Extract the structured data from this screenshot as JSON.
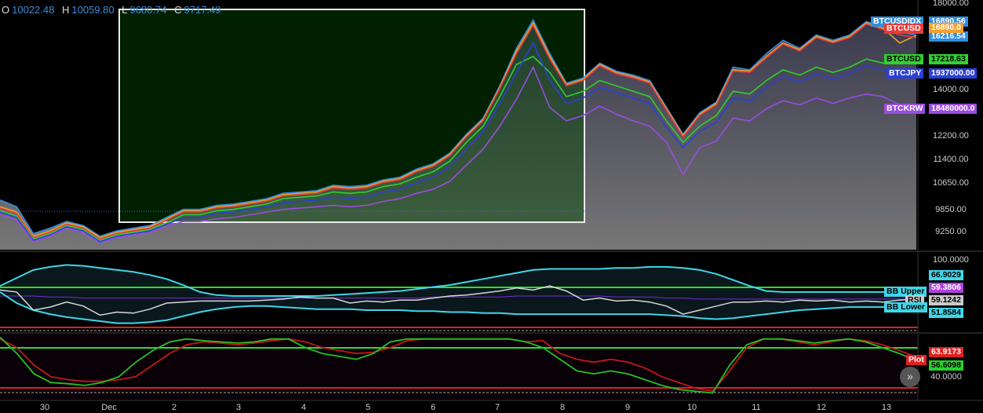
{
  "ohlc": {
    "o_label": "O",
    "o": "10022.48",
    "h_label": "H",
    "h": "10059.80",
    "l_label": "L",
    "l": "9680.74",
    "c_label": "C",
    "c": "9717.49"
  },
  "colors": {
    "BTCUSDIDX": "#2f8ee0",
    "BTCUSD_orange": "#f0a030",
    "BTCUSD_red": "#e83a3a",
    "BTCUSD_green": "#30d030",
    "BTCJPY": "#2b3fd8",
    "BTCKRW": "#9a4ce0",
    "rsi": "#d8d8d8",
    "bb": "#3fd6e8",
    "stoch_k": "#26c026",
    "stoch_d": "#c01818"
  },
  "chart_data": [
    {
      "type": "line",
      "x_ticks": [
        "30",
        "Dec",
        "2",
        "3",
        "4",
        "5",
        "6",
        "7",
        "8",
        "9",
        "10",
        "11",
        "12",
        "13"
      ],
      "y_ticks": [
        "18000.00",
        "14000.00",
        "12200.00",
        "11400.00",
        "10650.00",
        "9850.00",
        "9250.00"
      ],
      "ylim": [
        8900,
        18200
      ],
      "series": [
        {
          "name": "BTCUSDIDX",
          "last_label": "16890.56",
          "values": [
            10750,
            10500,
            9500,
            9700,
            9950,
            9800,
            9400,
            9600,
            9700,
            9800,
            10100,
            10400,
            10400,
            10550,
            10600,
            10700,
            10800,
            11000,
            11050,
            11100,
            11300,
            11250,
            11300,
            11500,
            11600,
            11900,
            12100,
            12500,
            13200,
            13800,
            15000,
            16400,
            17450,
            16200,
            15100,
            15300,
            15850,
            15550,
            15400,
            15200,
            14200,
            13200,
            14000,
            14400,
            15700,
            15600,
            16200,
            16700,
            16400,
            16900,
            16700,
            16900,
            17400,
            17200,
            17000,
            16900
          ]
        },
        {
          "name": "BTCUSD",
          "last_label": "16890.0",
          "values": [
            10500,
            10300,
            9400,
            9600,
            9900,
            9750,
            9350,
            9550,
            9650,
            9750,
            10050,
            10350,
            10350,
            10500,
            10550,
            10650,
            10750,
            10950,
            11000,
            11050,
            11250,
            11200,
            11250,
            11450,
            11550,
            11850,
            12050,
            12450,
            13150,
            13750,
            14950,
            16300,
            17350,
            16100,
            15050,
            15250,
            15800,
            15500,
            15350,
            15150,
            14150,
            13150,
            13950,
            14350,
            15600,
            15550,
            16100,
            16600,
            16350,
            16850,
            16650,
            16850,
            17350,
            17150,
            16600,
            16880
          ]
        },
        {
          "name": "BTCUSD",
          "last_label": "16216.54",
          "values": [
            10450,
            10250,
            9350,
            9550,
            9850,
            9700,
            9300,
            9500,
            9600,
            9700,
            10000,
            10300,
            10300,
            10450,
            10500,
            10600,
            10700,
            10900,
            10950,
            11000,
            11200,
            11150,
            11200,
            11400,
            11500,
            11800,
            12000,
            12400,
            13100,
            13700,
            14900,
            16200,
            17250,
            16000,
            15000,
            15200,
            15750,
            15450,
            15300,
            15100,
            14100,
            13100,
            13900,
            14300,
            15550,
            15500,
            16050,
            16550,
            16300,
            16800,
            16600,
            16800,
            17300,
            17100,
            16900,
            16800
          ]
        },
        {
          "name": "BTCUSD",
          "last_label": "17218.63",
          "values": [
            10350,
            10150,
            9300,
            9500,
            9800,
            9650,
            9250,
            9450,
            9550,
            9650,
            9900,
            10200,
            10200,
            10350,
            10400,
            10500,
            10600,
            10800,
            10850,
            10900,
            11050,
            11000,
            11050,
            11250,
            11350,
            11600,
            11800,
            12200,
            12900,
            13500,
            14600,
            15800,
            16100,
            15500,
            14600,
            14800,
            15200,
            15000,
            14800,
            14600,
            13700,
            12900,
            13500,
            13900,
            14800,
            14700,
            15200,
            15600,
            15400,
            15700,
            15500,
            15700,
            16000,
            15850,
            16000,
            16000
          ]
        },
        {
          "name": "BTCJPY",
          "last_label": "1937000.00",
          "values": [
            10300,
            10100,
            9250,
            9450,
            9750,
            9600,
            9200,
            9400,
            9500,
            9600,
            9850,
            10100,
            10100,
            10250,
            10300,
            10400,
            10500,
            10650,
            10700,
            10750,
            10850,
            10800,
            10850,
            11050,
            11150,
            11400,
            11600,
            12000,
            12650,
            13300,
            14350,
            15500,
            16600,
            15200,
            14350,
            14550,
            14950,
            14750,
            14550,
            14350,
            13450,
            12700,
            13300,
            13650,
            14550,
            14450,
            14950,
            15350,
            15150,
            15450,
            15250,
            15450,
            15750,
            15600,
            15450,
            15500
          ]
        },
        {
          "name": "BTCKRW",
          "last_label": "18480000.0",
          "values": [
            10200,
            10000,
            9200,
            9400,
            9700,
            9550,
            9150,
            9350,
            9450,
            9550,
            9750,
            9950,
            9950,
            10050,
            10100,
            10200,
            10300,
            10400,
            10450,
            10500,
            10550,
            10500,
            10550,
            10700,
            10800,
            11000,
            11150,
            11450,
            12050,
            12650,
            13500,
            14500,
            15700,
            14200,
            13700,
            13900,
            14250,
            13950,
            13700,
            13500,
            12900,
            11700,
            12700,
            12950,
            13800,
            13700,
            14150,
            14450,
            14300,
            14550,
            14350,
            14550,
            14700,
            14600,
            14300,
            14200
          ]
        }
      ]
    },
    {
      "type": "line",
      "y_ticks": [
        "100.0000"
      ],
      "ylim": [
        30,
        105
      ],
      "series": [
        {
          "name": "RSI",
          "last_label": "59.1242",
          "values": [
            68,
            66,
            48,
            51,
            56,
            52,
            43,
            46,
            45,
            49,
            55,
            56,
            57,
            57,
            57,
            57,
            58,
            59,
            61,
            60,
            60,
            55,
            57,
            56,
            58,
            58,
            60,
            62,
            63,
            65,
            67,
            70,
            68,
            72,
            67,
            58,
            60,
            57,
            58,
            56,
            52,
            44,
            48,
            52,
            56,
            56,
            57,
            56,
            58,
            57,
            58,
            56,
            57,
            56,
            58,
            59
          ]
        },
        {
          "name": "BB Upper",
          "last_label": "66.9029",
          "values": [
            72,
            80,
            88,
            91,
            93,
            92,
            90,
            88,
            86,
            83,
            79,
            73,
            66,
            63,
            62,
            62,
            62,
            62,
            62,
            62,
            63,
            64,
            65,
            66,
            67,
            69,
            71,
            73,
            76,
            79,
            82,
            85,
            88,
            89,
            89,
            89,
            89,
            90,
            90,
            91,
            91,
            90,
            88,
            84,
            78,
            72,
            67,
            66,
            66,
            66,
            66,
            66,
            66,
            66,
            66,
            67
          ]
        },
        {
          "name": "BB Lower",
          "last_label": "51.8584",
          "values": [
            66,
            55,
            48,
            44,
            41,
            39,
            37,
            35,
            35,
            36,
            38,
            42,
            46,
            49,
            51,
            52,
            52,
            51,
            50,
            49,
            49,
            49,
            48,
            48,
            48,
            47,
            47,
            46,
            46,
            45,
            45,
            44,
            44,
            44,
            44,
            44,
            44,
            44,
            44,
            44,
            43,
            42,
            40,
            39,
            40,
            42,
            44,
            46,
            48,
            49,
            50,
            51,
            51,
            51,
            52,
            52
          ]
        },
        {
          "name": "",
          "last_label": "59.3806",
          "values": [
            62,
            62,
            62,
            61,
            61,
            60,
            60,
            60,
            60,
            60,
            60,
            60,
            60,
            60,
            60,
            60,
            60,
            60,
            60,
            60,
            60,
            60,
            60,
            60,
            60,
            60,
            61,
            61,
            61,
            61,
            61,
            62,
            62,
            62,
            62,
            62,
            62,
            61,
            61,
            61,
            60,
            60,
            59,
            59,
            59,
            59,
            59,
            59,
            59,
            59,
            59,
            59,
            59,
            59,
            59,
            59
          ]
        }
      ]
    },
    {
      "type": "line",
      "y_ticks": [
        "40.0000"
      ],
      "ylim": [
        0,
        100
      ],
      "series": [
        {
          "name": "Plot",
          "last_label": "63.9173",
          "values": [
            95,
            80,
            50,
            30,
            25,
            22,
            22,
            25,
            30,
            50,
            70,
            85,
            90,
            88,
            85,
            88,
            92,
            95,
            90,
            80,
            75,
            70,
            72,
            80,
            92,
            95,
            95,
            95,
            95,
            95,
            95,
            90,
            92,
            70,
            60,
            55,
            60,
            55,
            45,
            30,
            20,
            10,
            5,
            40,
            80,
            95,
            95,
            90,
            85,
            90,
            95,
            92,
            85,
            75,
            64
          ]
        },
        {
          "name": "",
          "last_label": "56.6098",
          "values": [
            98,
            70,
            35,
            20,
            18,
            15,
            20,
            30,
            55,
            75,
            90,
            95,
            92,
            90,
            88,
            90,
            95,
            95,
            80,
            70,
            65,
            60,
            70,
            90,
            95,
            95,
            95,
            95,
            95,
            95,
            95,
            90,
            80,
            60,
            40,
            35,
            40,
            35,
            25,
            15,
            8,
            5,
            2,
            50,
            85,
            95,
            95,
            92,
            88,
            92,
            95,
            90,
            80,
            70,
            57
          ]
        }
      ]
    }
  ]
}
